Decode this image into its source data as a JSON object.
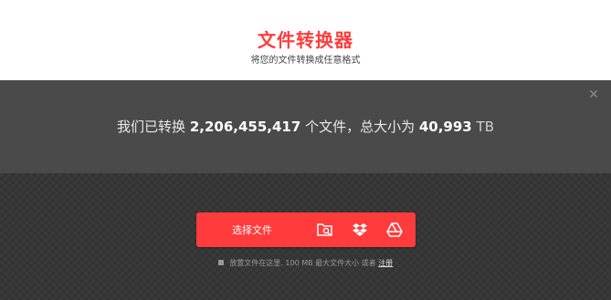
{
  "header": {
    "title": "文件转换器",
    "subtitle": "将您的文件转换成任意格式"
  },
  "stats": {
    "prefix": "我们已转换",
    "file_count": "2,206,455,417",
    "middle": "个文件，总大小为",
    "total_size": "40,993",
    "unit": "TB",
    "close_icon": "close-icon"
  },
  "upload": {
    "choose_label": "选择文件",
    "sources": [
      "folder-search-icon",
      "dropbox-icon",
      "google-drive-icon"
    ],
    "note_text": "放置文件在这里. 100 MB 最大文件大小 或者",
    "note_link": "注册"
  },
  "colors": {
    "accent": "#ff3b3b",
    "band": "#4a4a4a"
  }
}
